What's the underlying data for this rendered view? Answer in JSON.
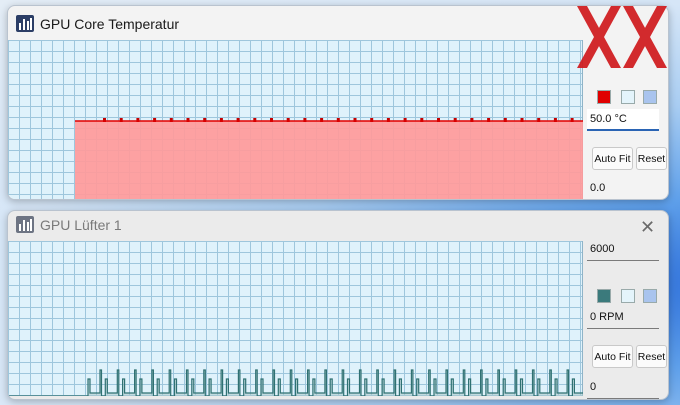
{
  "windows": [
    {
      "title": "GPU Core Temperatur",
      "max_value": "",
      "current_value": "50.0 °C",
      "min_value": "0.0",
      "auto_fit_label": "Auto Fit",
      "reset_label": "Reset",
      "line_color": "#e00000",
      "fill_color": "#ff9a9a",
      "swatches": [
        "#e00000",
        "#e4f4fb",
        "#a9c4ee"
      ]
    },
    {
      "title": "GPU Lüfter 1",
      "max_value": "6000",
      "current_value": "0 RPM",
      "min_value": "0",
      "auto_fit_label": "Auto Fit",
      "reset_label": "Reset",
      "line_color": "#2f7172",
      "fill_color": "#a9c9cb",
      "swatches": [
        "#3b7a7c",
        "#e4f4fb",
        "#a9c4ee"
      ]
    }
  ],
  "colors": {
    "accent": "#2a64b4",
    "grid": "#9ec6dc",
    "plot_bg": "#dff2fb",
    "logo": "#d0191d"
  },
  "icons": {
    "app": "bar-chart-app-icon",
    "close": "close-icon",
    "overlay": "xx-logo"
  }
}
